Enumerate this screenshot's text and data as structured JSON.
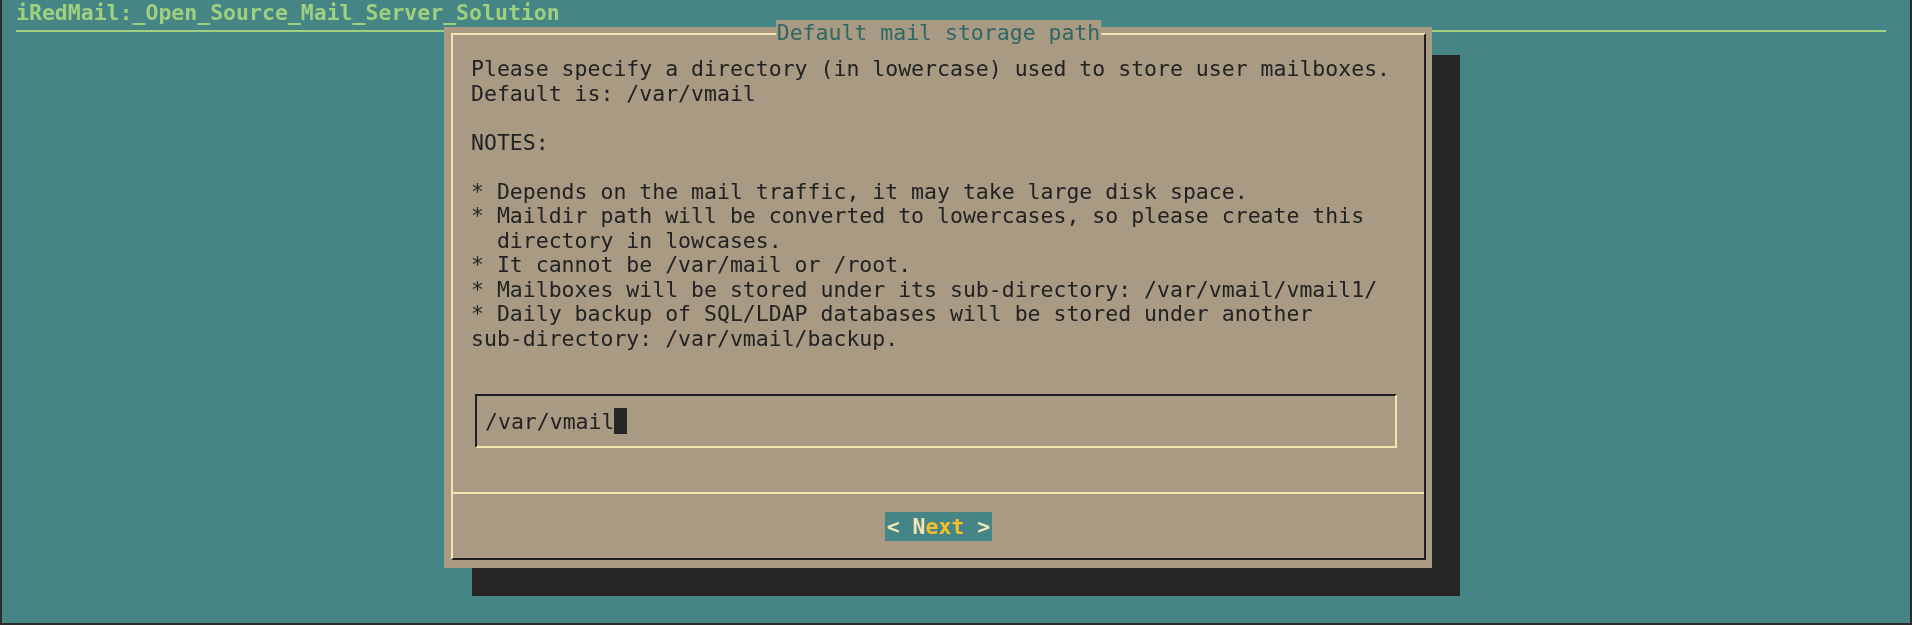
{
  "window": {
    "title": "iRedMail:_Open_Source_Mail_Server_Solution"
  },
  "dialog": {
    "title": "Default mail storage path",
    "paragraphs": [
      [
        "Please specify a directory (in lowercase) used to store user mailboxes.",
        "Default is: /var/vmail"
      ],
      [
        "NOTES:"
      ],
      [
        "* Depends on the mail traffic, it may take large disk space.",
        "* Maildir path will be converted to lowercases, so please create this",
        "  directory in lowcases.",
        "* It cannot be /var/mail or /root.",
        "* Mailboxes will be stored under its sub-directory: /var/vmail/vmail1/",
        "* Daily backup of SQL/LDAP databases will be stored under another",
        "sub-directory: /var/vmail/backup."
      ]
    ],
    "input": {
      "value": "/var/vmail"
    },
    "buttons": [
      {
        "left": "<",
        "label": "Next",
        "right": ">",
        "selected": true
      }
    ]
  }
}
